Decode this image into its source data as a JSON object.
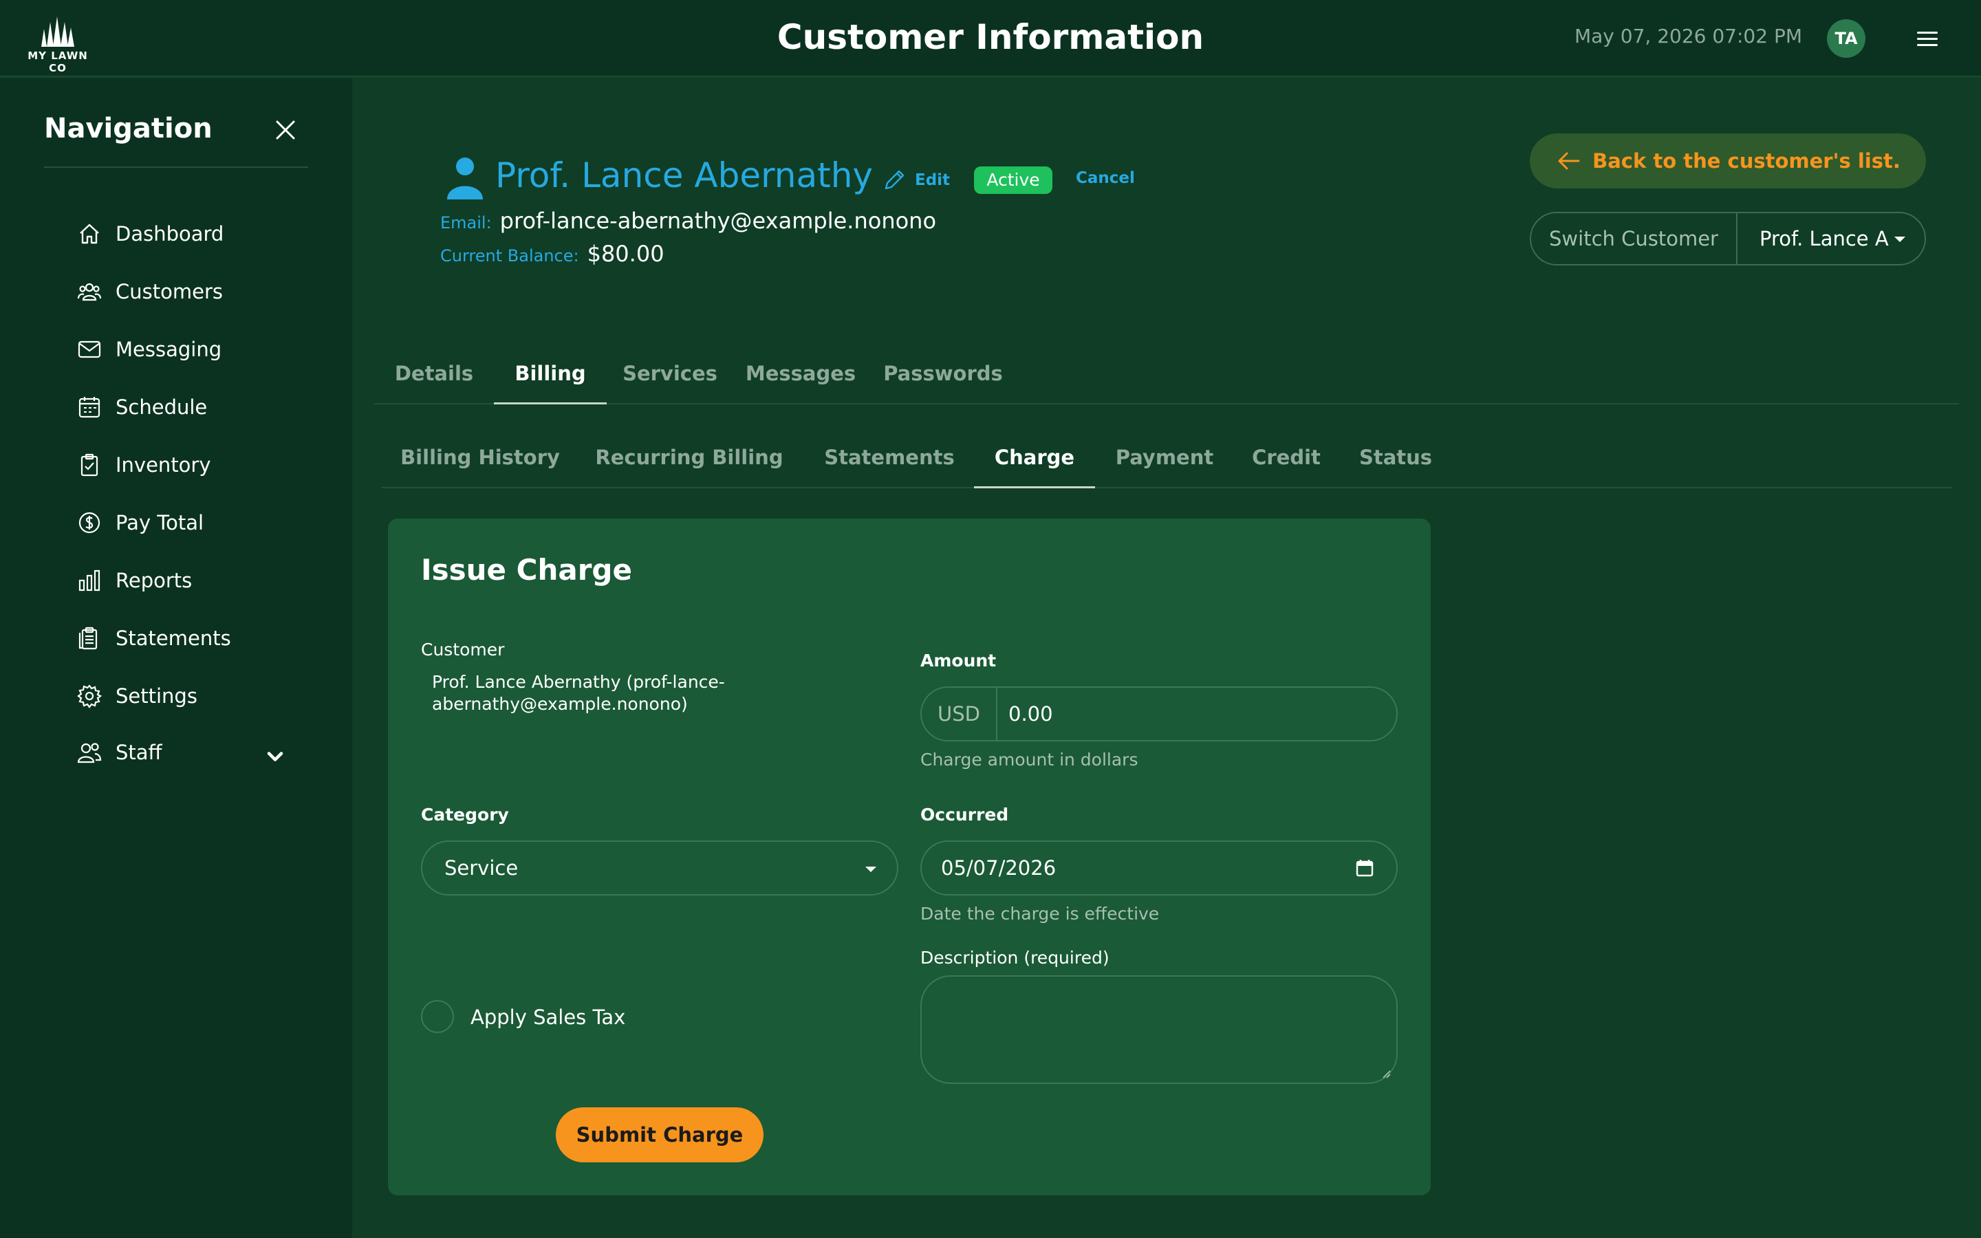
{
  "header": {
    "logo_text": "MY LAWN CO",
    "title": "Customer Information",
    "datetime": "May 07, 2026 07:02 PM",
    "user_initials": "TA"
  },
  "sidebar": {
    "title": "Navigation",
    "items": [
      {
        "label": "Dashboard",
        "icon": "home-icon"
      },
      {
        "label": "Customers",
        "icon": "users-icon"
      },
      {
        "label": "Messaging",
        "icon": "envelope-icon"
      },
      {
        "label": "Schedule",
        "icon": "calendar-icon"
      },
      {
        "label": "Inventory",
        "icon": "clipboard-check-icon"
      },
      {
        "label": "Pay Total",
        "icon": "dollar-circle-icon"
      },
      {
        "label": "Reports",
        "icon": "bar-chart-icon"
      },
      {
        "label": "Statements",
        "icon": "documents-icon"
      },
      {
        "label": "Settings",
        "icon": "gear-icon"
      },
      {
        "label": "Staff",
        "icon": "staff-icon",
        "expandable": true
      }
    ]
  },
  "customer": {
    "name": "Prof. Lance Abernathy",
    "edit_label": "Edit",
    "status": "Active",
    "cancel_label": "Cancel",
    "email_label": "Email:",
    "email": "prof-lance-abernathy@example.nonono",
    "balance_label": "Current Balance:",
    "balance": "$80.00"
  },
  "actions": {
    "back_label": "Back to the customer's list.",
    "switch_label": "Switch Customer",
    "switch_value": "Prof. Lance Abernathy"
  },
  "tabs": {
    "main": [
      "Details",
      "Billing",
      "Services",
      "Messages",
      "Passwords"
    ],
    "main_active": "Billing",
    "sub": [
      "Billing History",
      "Recurring Billing",
      "Statements",
      "Charge",
      "Payment",
      "Credit",
      "Status"
    ],
    "sub_active": "Charge"
  },
  "form": {
    "title": "Issue Charge",
    "customer_label": "Customer",
    "customer_value": "Prof. Lance Abernathy (prof-lance-abernathy@example.nonono)",
    "amount_label": "Amount",
    "amount_prefix": "USD",
    "amount_value": "0.00",
    "amount_help": "Charge amount in dollars",
    "category_label": "Category",
    "category_value": "Service",
    "occurred_label": "Occurred",
    "occurred_value": "05/07/2026",
    "occurred_help": "Date the charge is effective",
    "description_label": "Description (required)",
    "description_value": "",
    "tax_label": "Apply Sales Tax",
    "tax_checked": false,
    "submit_label": "Submit Charge"
  },
  "colors": {
    "background": "#0f3d26",
    "sidebar": "#0b3220",
    "card": "#1a5a36",
    "link_blue": "#27a9e1",
    "accent_orange": "#f7941d",
    "active_green": "#1ec15c"
  }
}
